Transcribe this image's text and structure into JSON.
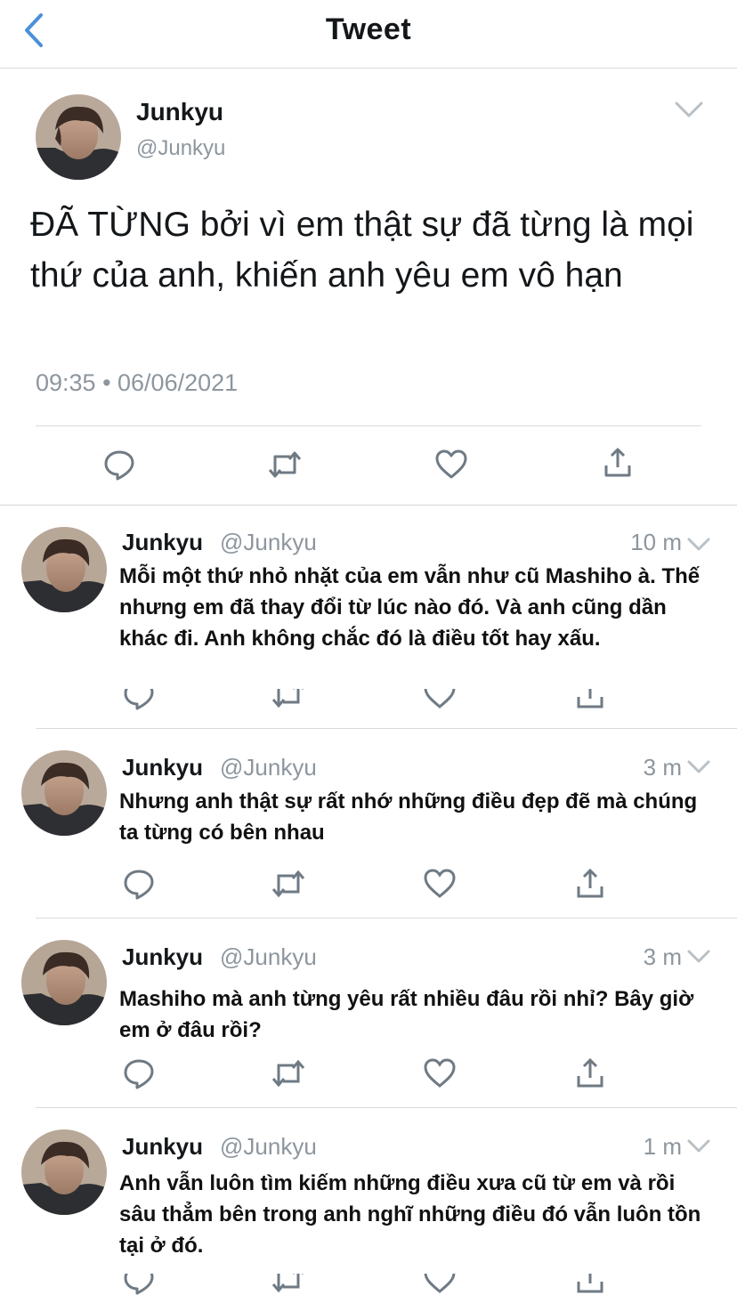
{
  "header": {
    "title": "Tweet",
    "back_icon": "chevron-left-icon"
  },
  "colors": {
    "accent": "#4a90d9",
    "muted": "#8d969e",
    "text": "#14171a"
  },
  "main_tweet": {
    "name": "Junkyu",
    "handle": "@Junkyu",
    "text": "ĐÃ TỪNG bởi vì em thật sự đã từng là mọi thứ của anh, khiến anh yêu em vô hạn",
    "timestamp": "09:35 • 06/06/2021",
    "actions": [
      "reply-icon",
      "retweet-icon",
      "like-icon",
      "share-icon"
    ]
  },
  "replies": [
    {
      "name": "Junkyu",
      "handle": "@Junkyu",
      "time": "10 m",
      "text": "Mỗi một thứ nhỏ nhặt của em vẫn như cũ Mashiho à. Thế nhưng em đã thay đổi từ lúc nào đó. Và anh cũng dần khác đi. Anh không chắc đó là điều tốt hay xấu."
    },
    {
      "name": "Junkyu",
      "handle": "@Junkyu",
      "time": "3 m",
      "text": "Nhưng anh thật sự rất nhớ những điều đẹp đẽ mà chúng ta từng có bên nhau"
    },
    {
      "name": "Junkyu",
      "handle": "@Junkyu",
      "time": "3 m",
      "text": "Mashiho mà anh từng yêu rất nhiều đâu rồi nhỉ? Bây giờ em ở đâu rồi?"
    },
    {
      "name": "Junkyu",
      "handle": "@Junkyu",
      "time": "1 m",
      "text": "Anh vẫn luôn tìm kiếm những điều xưa cũ từ em và rồi sâu thẳm bên trong anh nghĩ những điều đó vẫn luôn tồn tại ở đó."
    }
  ]
}
